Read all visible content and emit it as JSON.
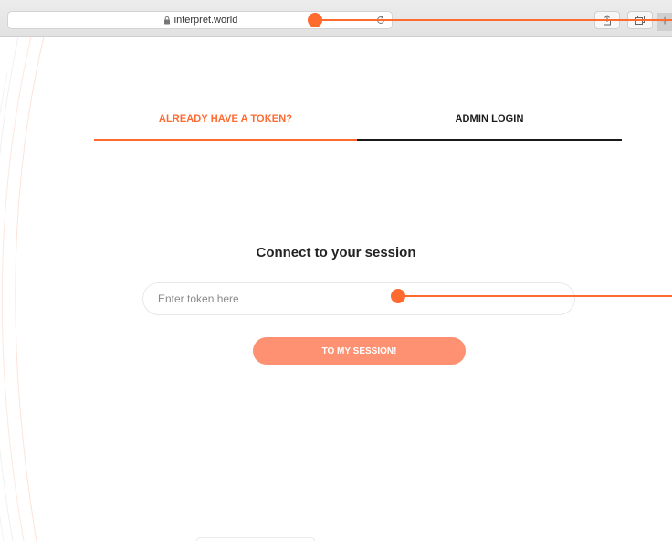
{
  "browser": {
    "url": "interpret.world",
    "icons": [
      "lock-icon",
      "reload-icon",
      "share-icon",
      "tabs-icon",
      "plus-icon"
    ]
  },
  "tabs": [
    {
      "label": "ALREADY HAVE A TOKEN?",
      "active": true
    },
    {
      "label": "ADMIN LOGIN",
      "active": false
    }
  ],
  "main": {
    "heading": "Connect to your session",
    "token_input": {
      "value": "",
      "placeholder": "Enter token here"
    },
    "submit_label": "TO MY SESSION!"
  },
  "colors": {
    "accent": "#ff6a2f",
    "button": "#ff9173",
    "inactive_tab": "#1a1a1a"
  }
}
